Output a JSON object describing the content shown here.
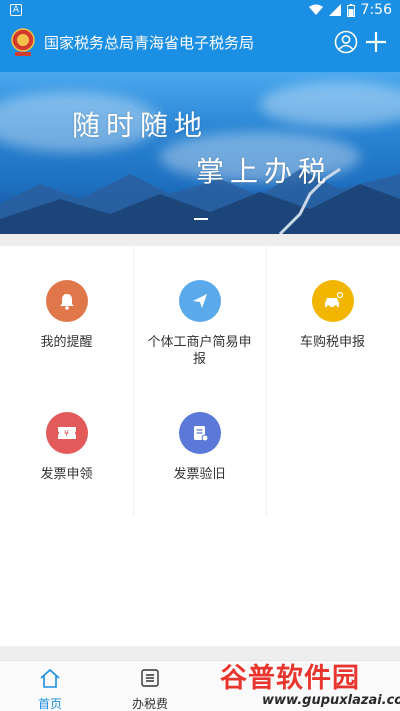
{
  "status_bar": {
    "notification_glyph": "A",
    "time": "7:56",
    "icons": [
      "wifi-icon",
      "signal-icon",
      "battery-icon"
    ]
  },
  "header": {
    "title": "国家税务总局青海省电子税务局",
    "background": "#1a8fe3",
    "icons": [
      "tax-emblem-logo",
      "user-icon",
      "plus-icon"
    ]
  },
  "banner": {
    "line1": "随时随地",
    "line2": "掌上办税"
  },
  "grid": {
    "items": [
      {
        "label": "我的提醒",
        "icon": "bell-icon",
        "color": "#e0774a"
      },
      {
        "label": "个体工商户简易申报",
        "icon": "paper-plane-icon",
        "color": "#5aa9ea"
      },
      {
        "label": "车购税申报",
        "icon": "car-icon",
        "color": "#f2b500"
      },
      {
        "label": "发票申领",
        "icon": "ticket-icon",
        "color": "#e35a5a"
      },
      {
        "label": "发票验旧",
        "icon": "invoice-check-icon",
        "color": "#5a79d8"
      }
    ]
  },
  "tabs": [
    {
      "label": "首页",
      "icon": "home-icon",
      "active": true,
      "color": "#1a8fe3"
    },
    {
      "label": "办税费",
      "icon": "list-icon",
      "active": false,
      "color": "#333333"
    }
  ],
  "watermark": {
    "brand": "谷普软件园",
    "url": "www.gupuxlazai.com"
  }
}
